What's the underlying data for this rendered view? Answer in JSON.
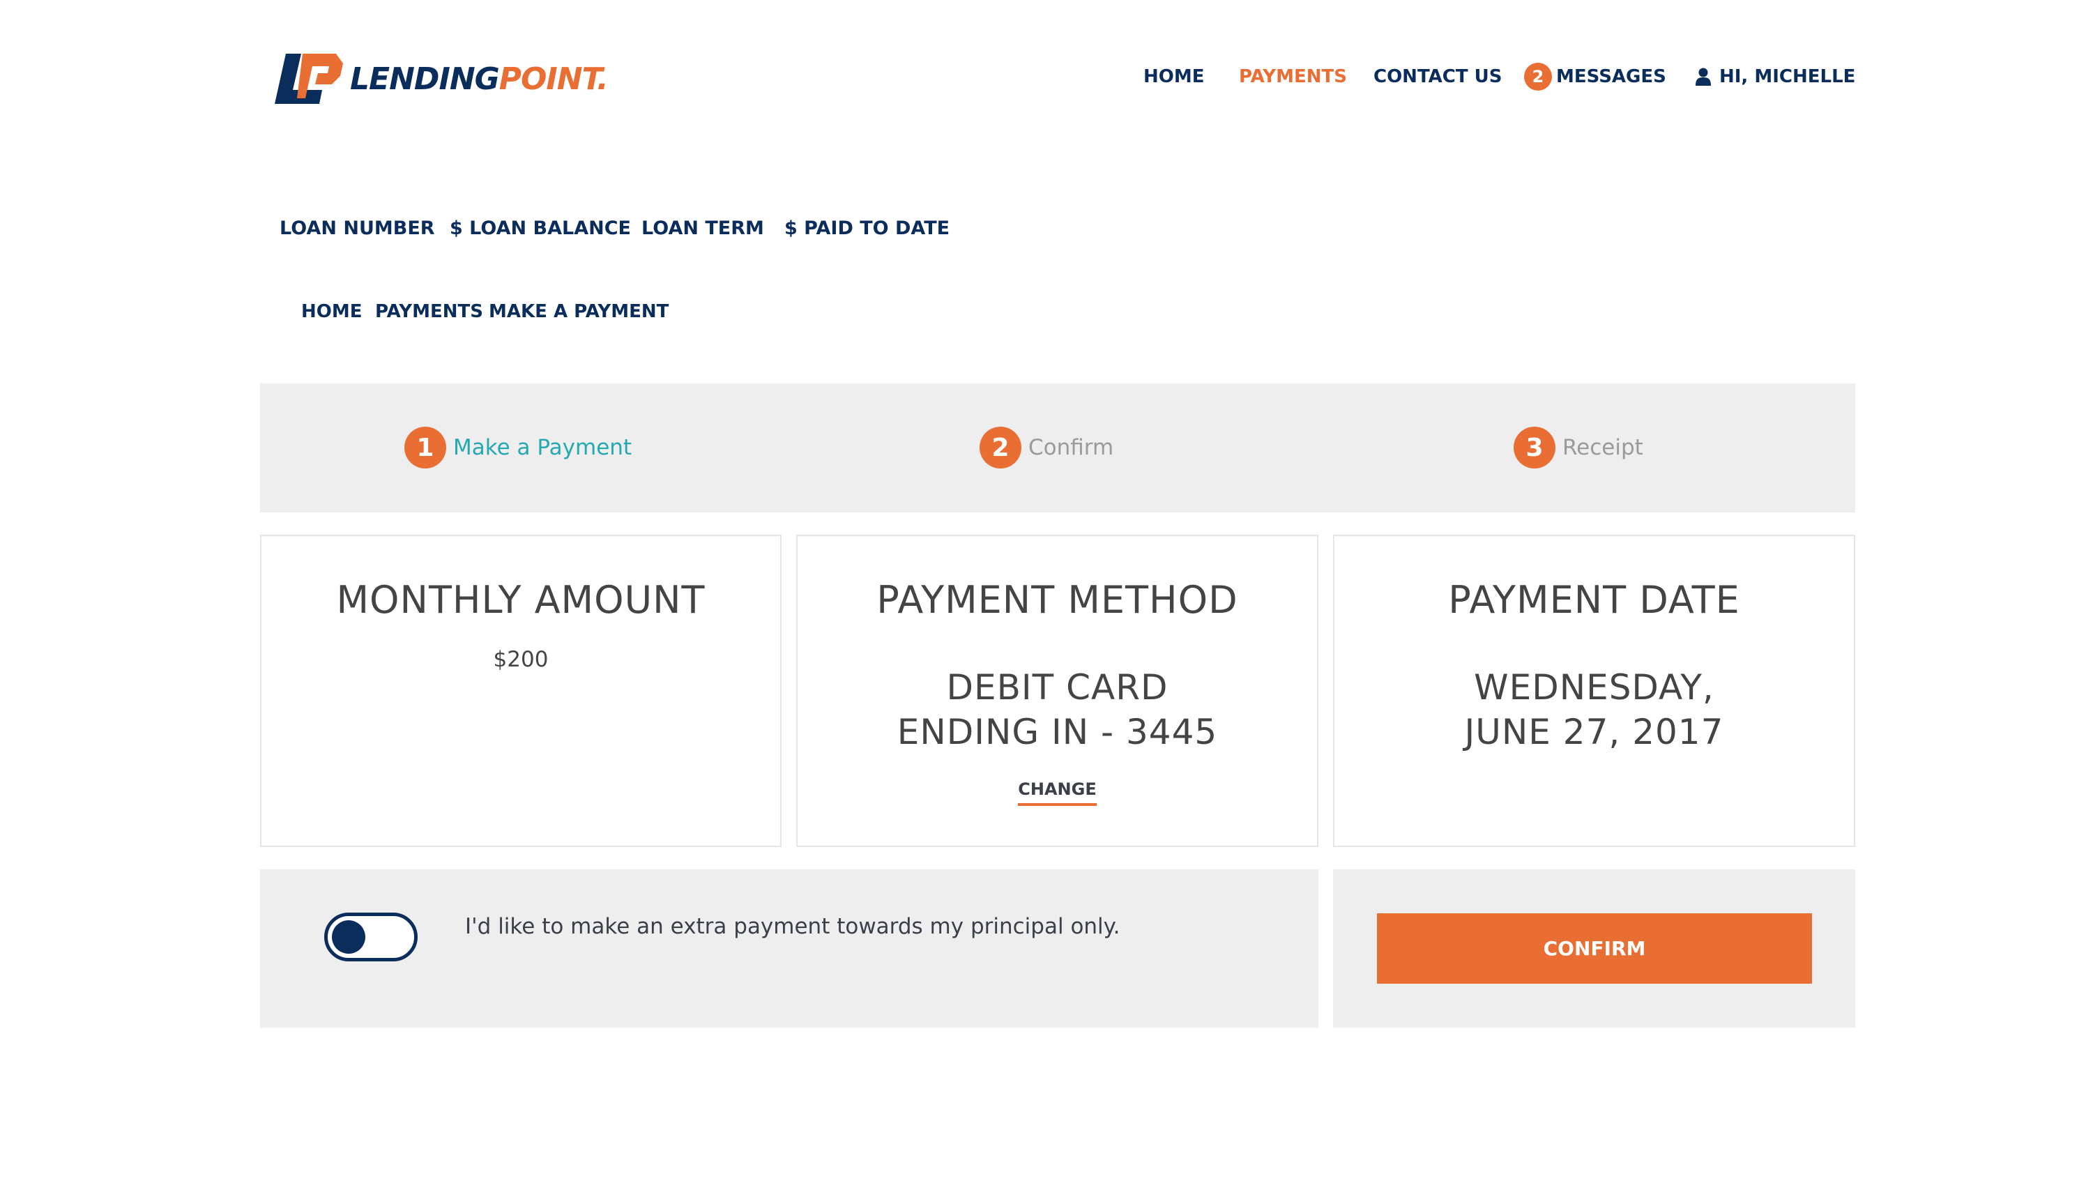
{
  "brand": {
    "logo_mark": "LP",
    "name_part1": "LENDING",
    "name_part2": "POINT",
    "name_suffix": "."
  },
  "topnav": {
    "home": "HOME",
    "payments": "PAYMENTS",
    "contact": "CONTACT US",
    "messages_count": "2",
    "messages": "MESSAGES",
    "user": "HI, MICHELLE"
  },
  "loan_summary": {
    "loan_number": "LOAN NUMBER",
    "loan_balance": "$ LOAN BALANCE",
    "loan_term": "LOAN TERM",
    "paid_to_date": "$ PAID TO DATE"
  },
  "breadcrumb": [
    "HOME",
    "PAYMENTS",
    "MAKE A PAYMENT"
  ],
  "steps": [
    {
      "num": "1",
      "label": "Make a Payment",
      "state": "active"
    },
    {
      "num": "2",
      "label": "Confirm",
      "state": "inactive"
    },
    {
      "num": "3",
      "label": "Receipt",
      "state": "inactive"
    }
  ],
  "cards": {
    "monthly_amount": {
      "title": "MONTHLY AMOUNT",
      "value": "$200"
    },
    "payment_method": {
      "title": "PAYMENT METHOD",
      "line1": "DEBIT CARD",
      "line2": "ENDING IN - 3445",
      "change": "CHANGE"
    },
    "payment_date": {
      "title": "PAYMENT DATE",
      "line1": "WEDNESDAY,",
      "line2": "JUNE 27, 2017"
    }
  },
  "extra_payment": {
    "label": "I'd like to make an extra payment towards my principal only.",
    "toggle_on": false
  },
  "confirm_label": "CONFIRM",
  "colors": {
    "navy": "#0b2d5b",
    "orange": "#e96e34",
    "teal": "#25a9b0",
    "panel_gray": "#eeeeee"
  }
}
